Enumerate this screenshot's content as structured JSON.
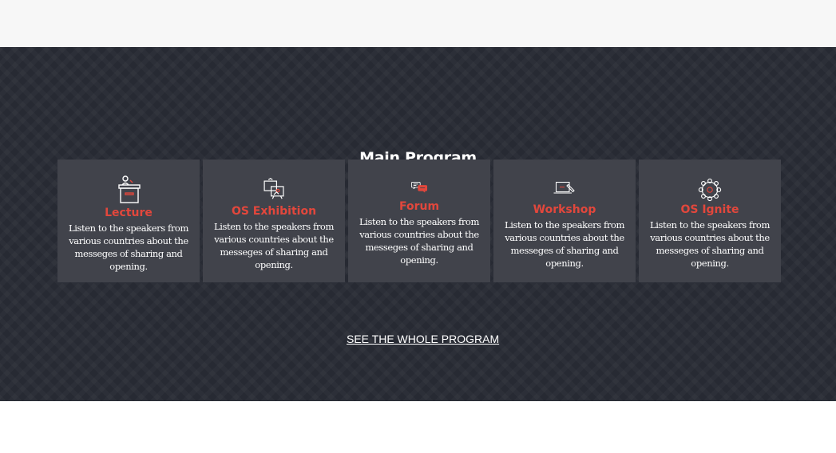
{
  "section": {
    "title": "Main Program",
    "accent_color": "#e2473c",
    "background_color": "#272a33",
    "card_color": "#41434b"
  },
  "cards": [
    {
      "title": "Lecture",
      "description": "Listen to the speakers from various countries about the messeges of sharing and opening.",
      "icon": "lectern-speaker-icon"
    },
    {
      "title": "OS Exhibition",
      "description": "Listen to the speakers from various countries about the messeges of sharing and opening.",
      "icon": "exhibition-screens-icon"
    },
    {
      "title": "Forum",
      "description": "Listen to the speakers from various countries about the messeges of sharing and opening.",
      "icon": "chat-bubbles-icon"
    },
    {
      "title": "Workshop",
      "description": "Listen to the speakers from various countries about the messeges of sharing and opening.",
      "icon": "laptop-pen-icon"
    },
    {
      "title": "OS Ignite",
      "description": "Listen to the speakers from various countries about the messeges of sharing and opening.",
      "icon": "network-circle-icon"
    }
  ],
  "cta": {
    "label": "SEE THE WHOLE PROGRAM"
  }
}
